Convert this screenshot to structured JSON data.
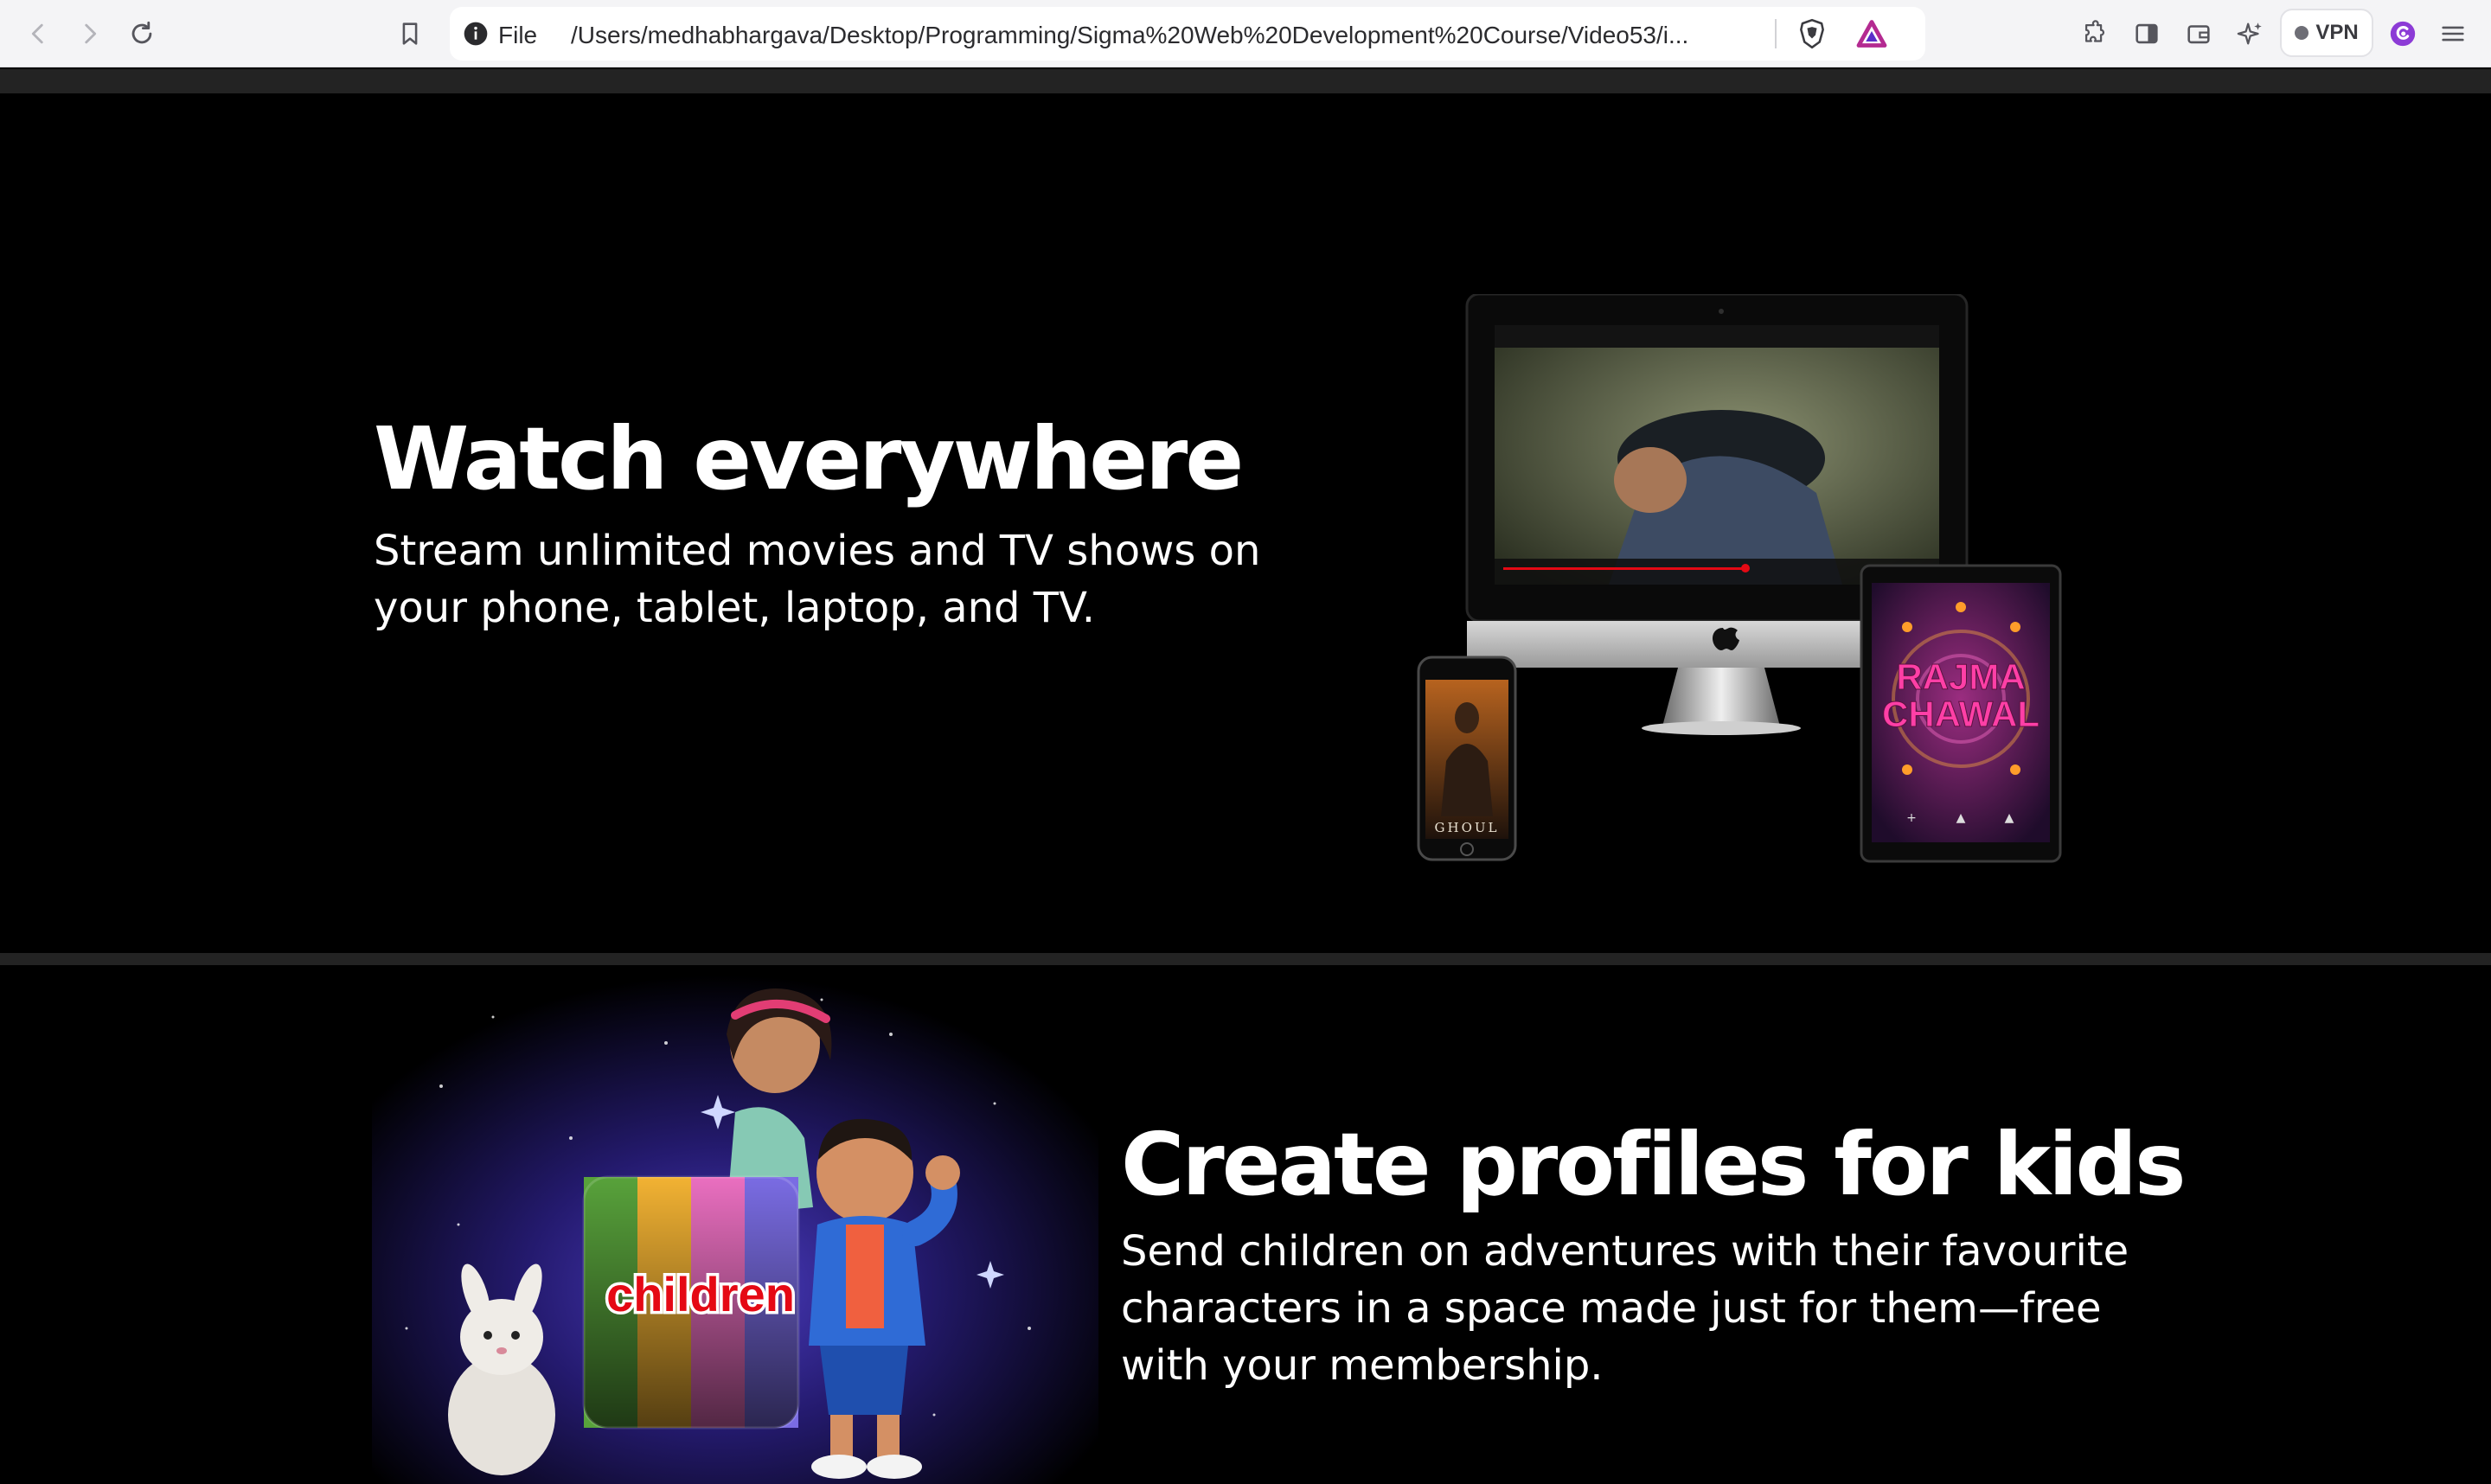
{
  "browser": {
    "url_scheme": "File",
    "url_path": "/Users/medhabhargava/Desktop/Programming/Sigma%20Web%20Development%20Course/Video53/i...",
    "vpn_label": "VPN"
  },
  "sections": {
    "watch": {
      "title": "Watch everywhere",
      "description": "Stream unlimited movies and TV shows on your phone, tablet, laptop, and TV.",
      "tablet_title_line1": "RAJMA",
      "tablet_title_line2": "CHAWAL",
      "phone_title": "GHOUL"
    },
    "kids": {
      "title": "Create profiles for kids",
      "description": "Send children on adventures with their favourite characters in a space made just for them—free with your membership.",
      "badge_label": "children"
    }
  },
  "colors": {
    "background": "#000000",
    "separator": "#232323",
    "text": "#ffffff",
    "accent_red": "#e50914"
  }
}
